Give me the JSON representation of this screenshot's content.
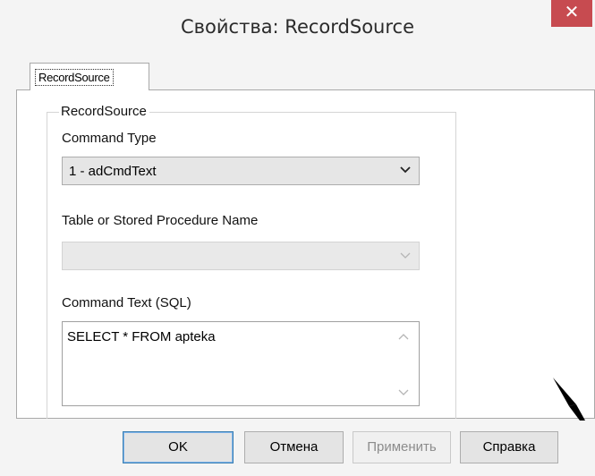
{
  "window": {
    "title": "Свойства: RecordSource",
    "close_glyph": "✕"
  },
  "tabs": [
    {
      "label": "RecordSource",
      "active": true
    }
  ],
  "group": {
    "legend": "RecordSource",
    "command_type": {
      "label": "Command Type",
      "value": "1 - adCmdText"
    },
    "table_name": {
      "label": "Table or Stored Procedure Name",
      "value": "",
      "enabled": false
    },
    "command_text": {
      "label": "Command Text (SQL)",
      "value": "SELECT * FROM apteka"
    }
  },
  "buttons": {
    "ok": "OK",
    "cancel": "Отмена",
    "apply": "Применить",
    "help": "Справка"
  },
  "colors": {
    "close_bg": "#c74b50",
    "default_button_border": "#3c7fb1",
    "watermark": "#000000"
  },
  "icons": {
    "close": "close-icon",
    "dropdown": "chevron-down-icon",
    "scroll_up": "scroll-up-arrow-icon",
    "scroll_down": "scroll-down-arrow-icon",
    "watermark": "watermark-corner-mark"
  }
}
